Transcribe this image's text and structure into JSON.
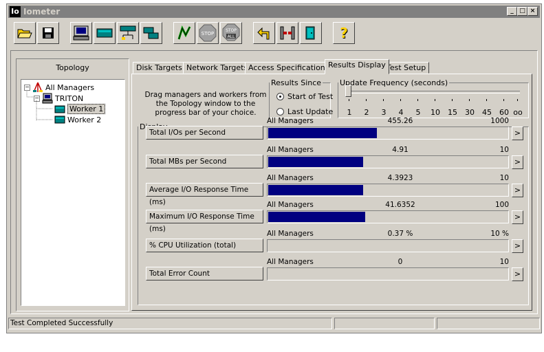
{
  "window": {
    "title": "Iometer",
    "app_icon_text": "Io",
    "minimize": "_",
    "maximize": "□",
    "close": "×"
  },
  "toolbar": {
    "stop_label": "STOP",
    "stop_all_label_top": "STOP",
    "stop_all_label_bottom": "ALL",
    "help_label": "?"
  },
  "topology": {
    "title": "Topology",
    "root": "All Managers",
    "manager": "TRITON",
    "workers": [
      "Worker 1",
      "Worker 2"
    ]
  },
  "tabs": [
    "Disk Targets",
    "Network Targets",
    "Access Specifications",
    "Results Display",
    "Test Setup"
  ],
  "results": {
    "drag_text": "Drag managers and workers from the Topology window to the progress bar of your choice.",
    "results_since": {
      "legend": "Results Since",
      "options": [
        "Start of Test",
        "Last Update"
      ],
      "selected": "Start of Test"
    },
    "update_frequency": {
      "legend": "Update Frequency (seconds)",
      "ticks": [
        "1",
        "2",
        "3",
        "4",
        "5",
        "10",
        "15",
        "30",
        "45",
        "60",
        "oo"
      ],
      "selected": "1"
    },
    "display_legend": "Display",
    "metrics": [
      {
        "label": "Total I/Os per Second",
        "source": "All Managers",
        "value": "455.26",
        "max": "1000",
        "fill": 0.4553
      },
      {
        "label": "Total MBs per Second",
        "source": "All Managers",
        "value": "4.91",
        "max": "10",
        "fill": 0.3964
      },
      {
        "label": "Average I/O Response Time (ms)",
        "source": "All Managers",
        "value": "4.3923",
        "max": "10",
        "fill": 0.3964
      },
      {
        "label": "Maximum I/O Response Time (ms)",
        "source": "All Managers",
        "value": "41.6352",
        "max": "100",
        "fill": 0.4049
      },
      {
        "label": "% CPU Utilization (total)",
        "source": "All Managers",
        "value": "0.37 %",
        "max": "10 %",
        "fill": 0.0
      },
      {
        "label": "Total Error Count",
        "source": "All Managers",
        "value": "0",
        "max": "10",
        "fill": 0.0
      }
    ],
    "arrow_label": ">"
  },
  "status": {
    "message": "Test Completed Successfully"
  },
  "colors": {
    "bar_fill": "#000080",
    "face": "#d4d0c8"
  }
}
